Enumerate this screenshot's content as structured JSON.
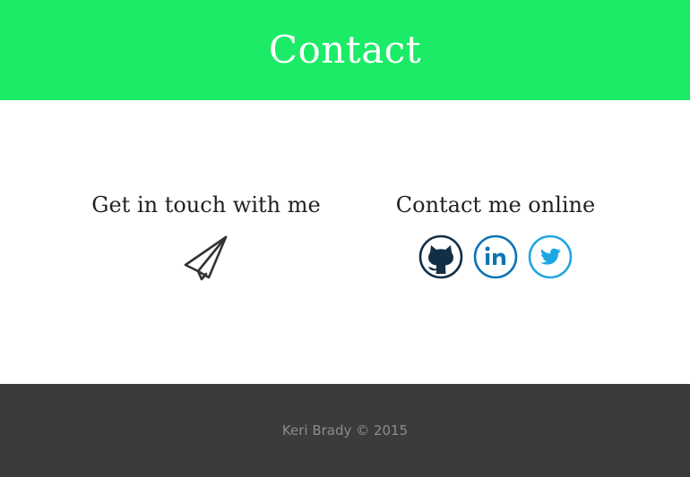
{
  "header": {
    "title": "Contact",
    "background_color": "#1beb66"
  },
  "contact_email": {
    "heading": "Get in touch with me",
    "icon": "paper-plane-icon"
  },
  "contact_online": {
    "heading": "Contact me online",
    "links": [
      {
        "icon": "github-icon",
        "color": "#132f45"
      },
      {
        "icon": "linkedin-icon",
        "color": "#0b74b5"
      },
      {
        "icon": "twitter-icon",
        "color": "#1da7e2"
      }
    ]
  },
  "footer": {
    "text": "Keri Brady © 2015",
    "background_color": "#3b3b3b"
  }
}
